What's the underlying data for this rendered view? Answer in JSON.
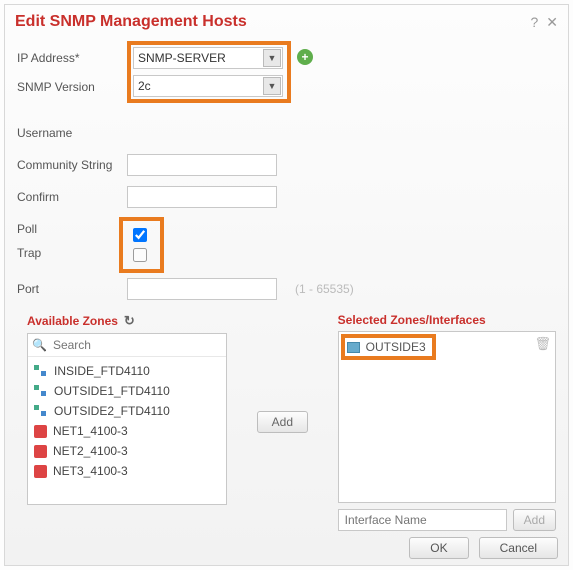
{
  "title": "Edit SNMP Management Hosts",
  "fields": {
    "ip_label": "IP Address*",
    "ip_value": "SNMP-SERVER",
    "version_label": "SNMP Version",
    "version_value": "2c",
    "username_label": "Username",
    "username_value": "",
    "community_label": "Community String",
    "community_value": "",
    "confirm_label": "Confirm",
    "confirm_value": "",
    "poll_label": "Poll",
    "trap_label": "Trap",
    "port_label": "Port",
    "port_value": "",
    "port_hint": "(1 - 65535)"
  },
  "poll_checked": true,
  "trap_checked": false,
  "available": {
    "title": "Available Zones",
    "search_placeholder": "Search",
    "items": [
      {
        "icon": "sec",
        "label": "INSIDE_FTD4110"
      },
      {
        "icon": "sec",
        "label": "OUTSIDE1_FTD4110"
      },
      {
        "icon": "sec",
        "label": "OUTSIDE2_FTD4110"
      },
      {
        "icon": "net",
        "label": "NET1_4100-3"
      },
      {
        "icon": "net",
        "label": "NET2_4100-3"
      },
      {
        "icon": "net",
        "label": "NET3_4100-3"
      }
    ]
  },
  "selected": {
    "title": "Selected Zones/Interfaces",
    "items": [
      {
        "icon": "grid",
        "label": "OUTSIDE3"
      }
    ],
    "interface_placeholder": "Interface Name"
  },
  "buttons": {
    "add": "Add",
    "add_iface": "Add",
    "ok": "OK",
    "cancel": "Cancel"
  }
}
